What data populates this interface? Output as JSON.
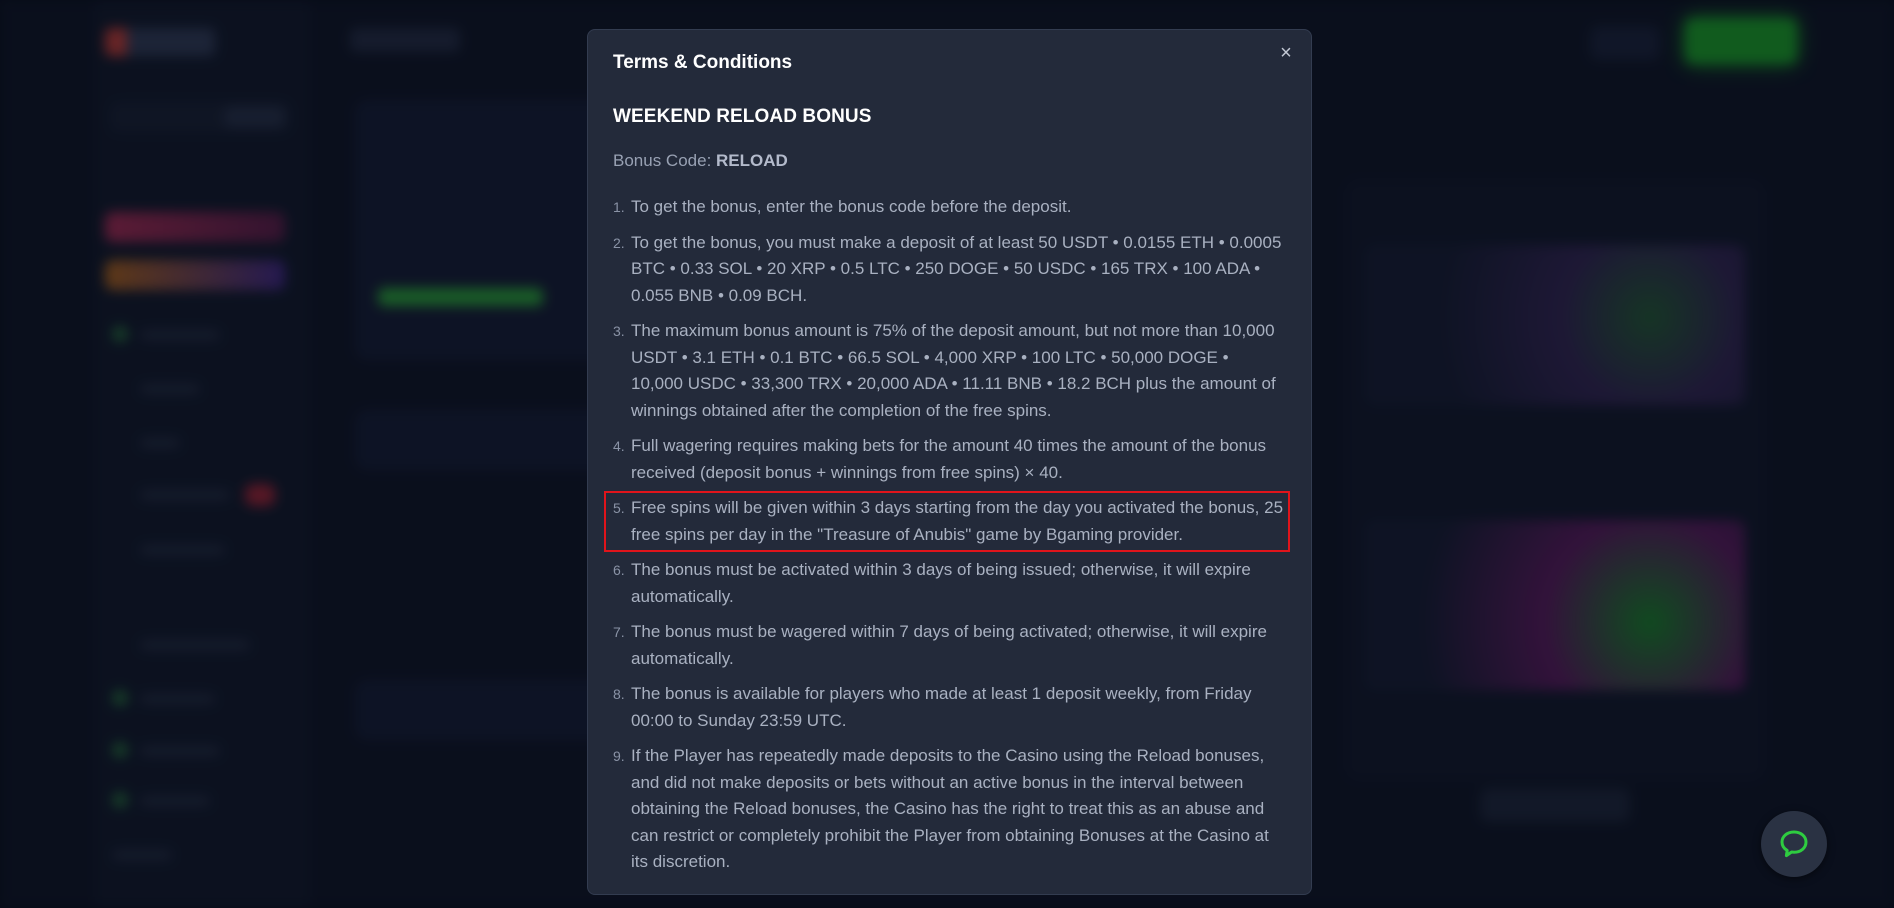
{
  "modal": {
    "title": "Terms & Conditions",
    "close_icon": "×",
    "bonus_title": "WEEKEND RELOAD BONUS",
    "bonus_code_label": "Bonus Code: ",
    "bonus_code_value": "RELOAD",
    "terms": [
      {
        "num": "1.",
        "text": "To get the bonus, enter the bonus code before the deposit."
      },
      {
        "num": "2.",
        "text": "To get the bonus, you must make a deposit of at least 50 USDT • 0.0155 ETH • 0.0005 BTC • 0.33 SOL • 20 XRP • 0.5 LTC • 250 DOGE • 50 USDC • 165 TRX • 100 ADA • 0.055 BNB • 0.09 BCH."
      },
      {
        "num": "3.",
        "text": "The maximum bonus amount is 75% of the deposit amount, but not more than 10,000 USDT • 3.1 ETH • 0.1 BTC • 66.5 SOL • 4,000 XRP • 100 LTC • 50,000 DOGE • 10,000 USDC • 33,300 TRX • 20,000 ADA • 11.11 BNB • 18.2 BCH plus the amount of winnings obtained after the completion of the free spins."
      },
      {
        "num": "4.",
        "text": "Full wagering requires making bets for the amount 40 times the amount of the bonus received (deposit bonus + winnings from free spins) × 40."
      },
      {
        "num": "5.",
        "text": "Free spins will be given within 3 days starting from the day you activated the bonus, 25 free spins per day in the \"Treasure of Anubis\" game by Bgaming provider."
      },
      {
        "num": "6.",
        "text": "The bonus must be activated within 3 days of being issued; otherwise, it will expire automatically."
      },
      {
        "num": "7.",
        "text": "The bonus must be wagered within 7 days of being activated; otherwise, it will expire automatically."
      },
      {
        "num": "8.",
        "text": "The bonus is available for players who made at least 1 deposit weekly, from Friday 00:00 to Sunday 23:59 UTC."
      },
      {
        "num": "9.",
        "text": "If the Player has repeatedly made deposits to the Casino using the Reload bonuses, and did not make deposits or bets without an active bonus in the interval between obtaining the Reload bonuses, the Casino has the right to treat this as an abuse and can restrict or completely prohibit the Player from obtaining Bonuses at the Casino at its discretion."
      }
    ]
  },
  "chat": {
    "icon": "chat-bubble-icon",
    "icon_color": "#2ecc40"
  },
  "colors": {
    "highlight_outline": "#e0141b",
    "modal_background": "#232a3a"
  }
}
